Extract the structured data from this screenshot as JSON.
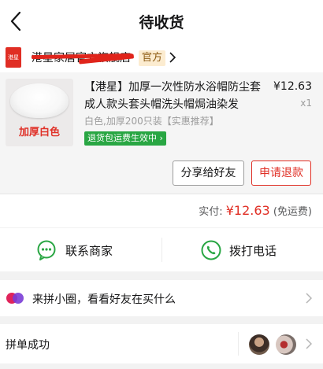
{
  "header": {
    "title": "待收货"
  },
  "shop": {
    "logo_text": "港星",
    "name": "港星家居官方旗舰店",
    "official_tag": "官方"
  },
  "product": {
    "thumb_label": "加厚白色",
    "title": "【港星】加厚一次性防水浴帽防尘套成人款头套头帽洗头帽焗油染发",
    "price": "¥12.63",
    "qty": "x1",
    "spec": "白色,加厚200只装【实惠推荐】",
    "badge": "退货包运费生效中"
  },
  "actions": {
    "share": "分享给好友",
    "refund": "申请退款"
  },
  "payment": {
    "label": "实付:",
    "amount": "¥12.63",
    "note": "(免运费)"
  },
  "contact": {
    "merchant": "联系商家",
    "phone": "拨打电话"
  },
  "circle": {
    "text": "来拼小圈，看看好友在买什么"
  },
  "group": {
    "text": "拼单成功"
  },
  "colors": {
    "accent_red": "#e02e24",
    "green": "#29a643"
  }
}
